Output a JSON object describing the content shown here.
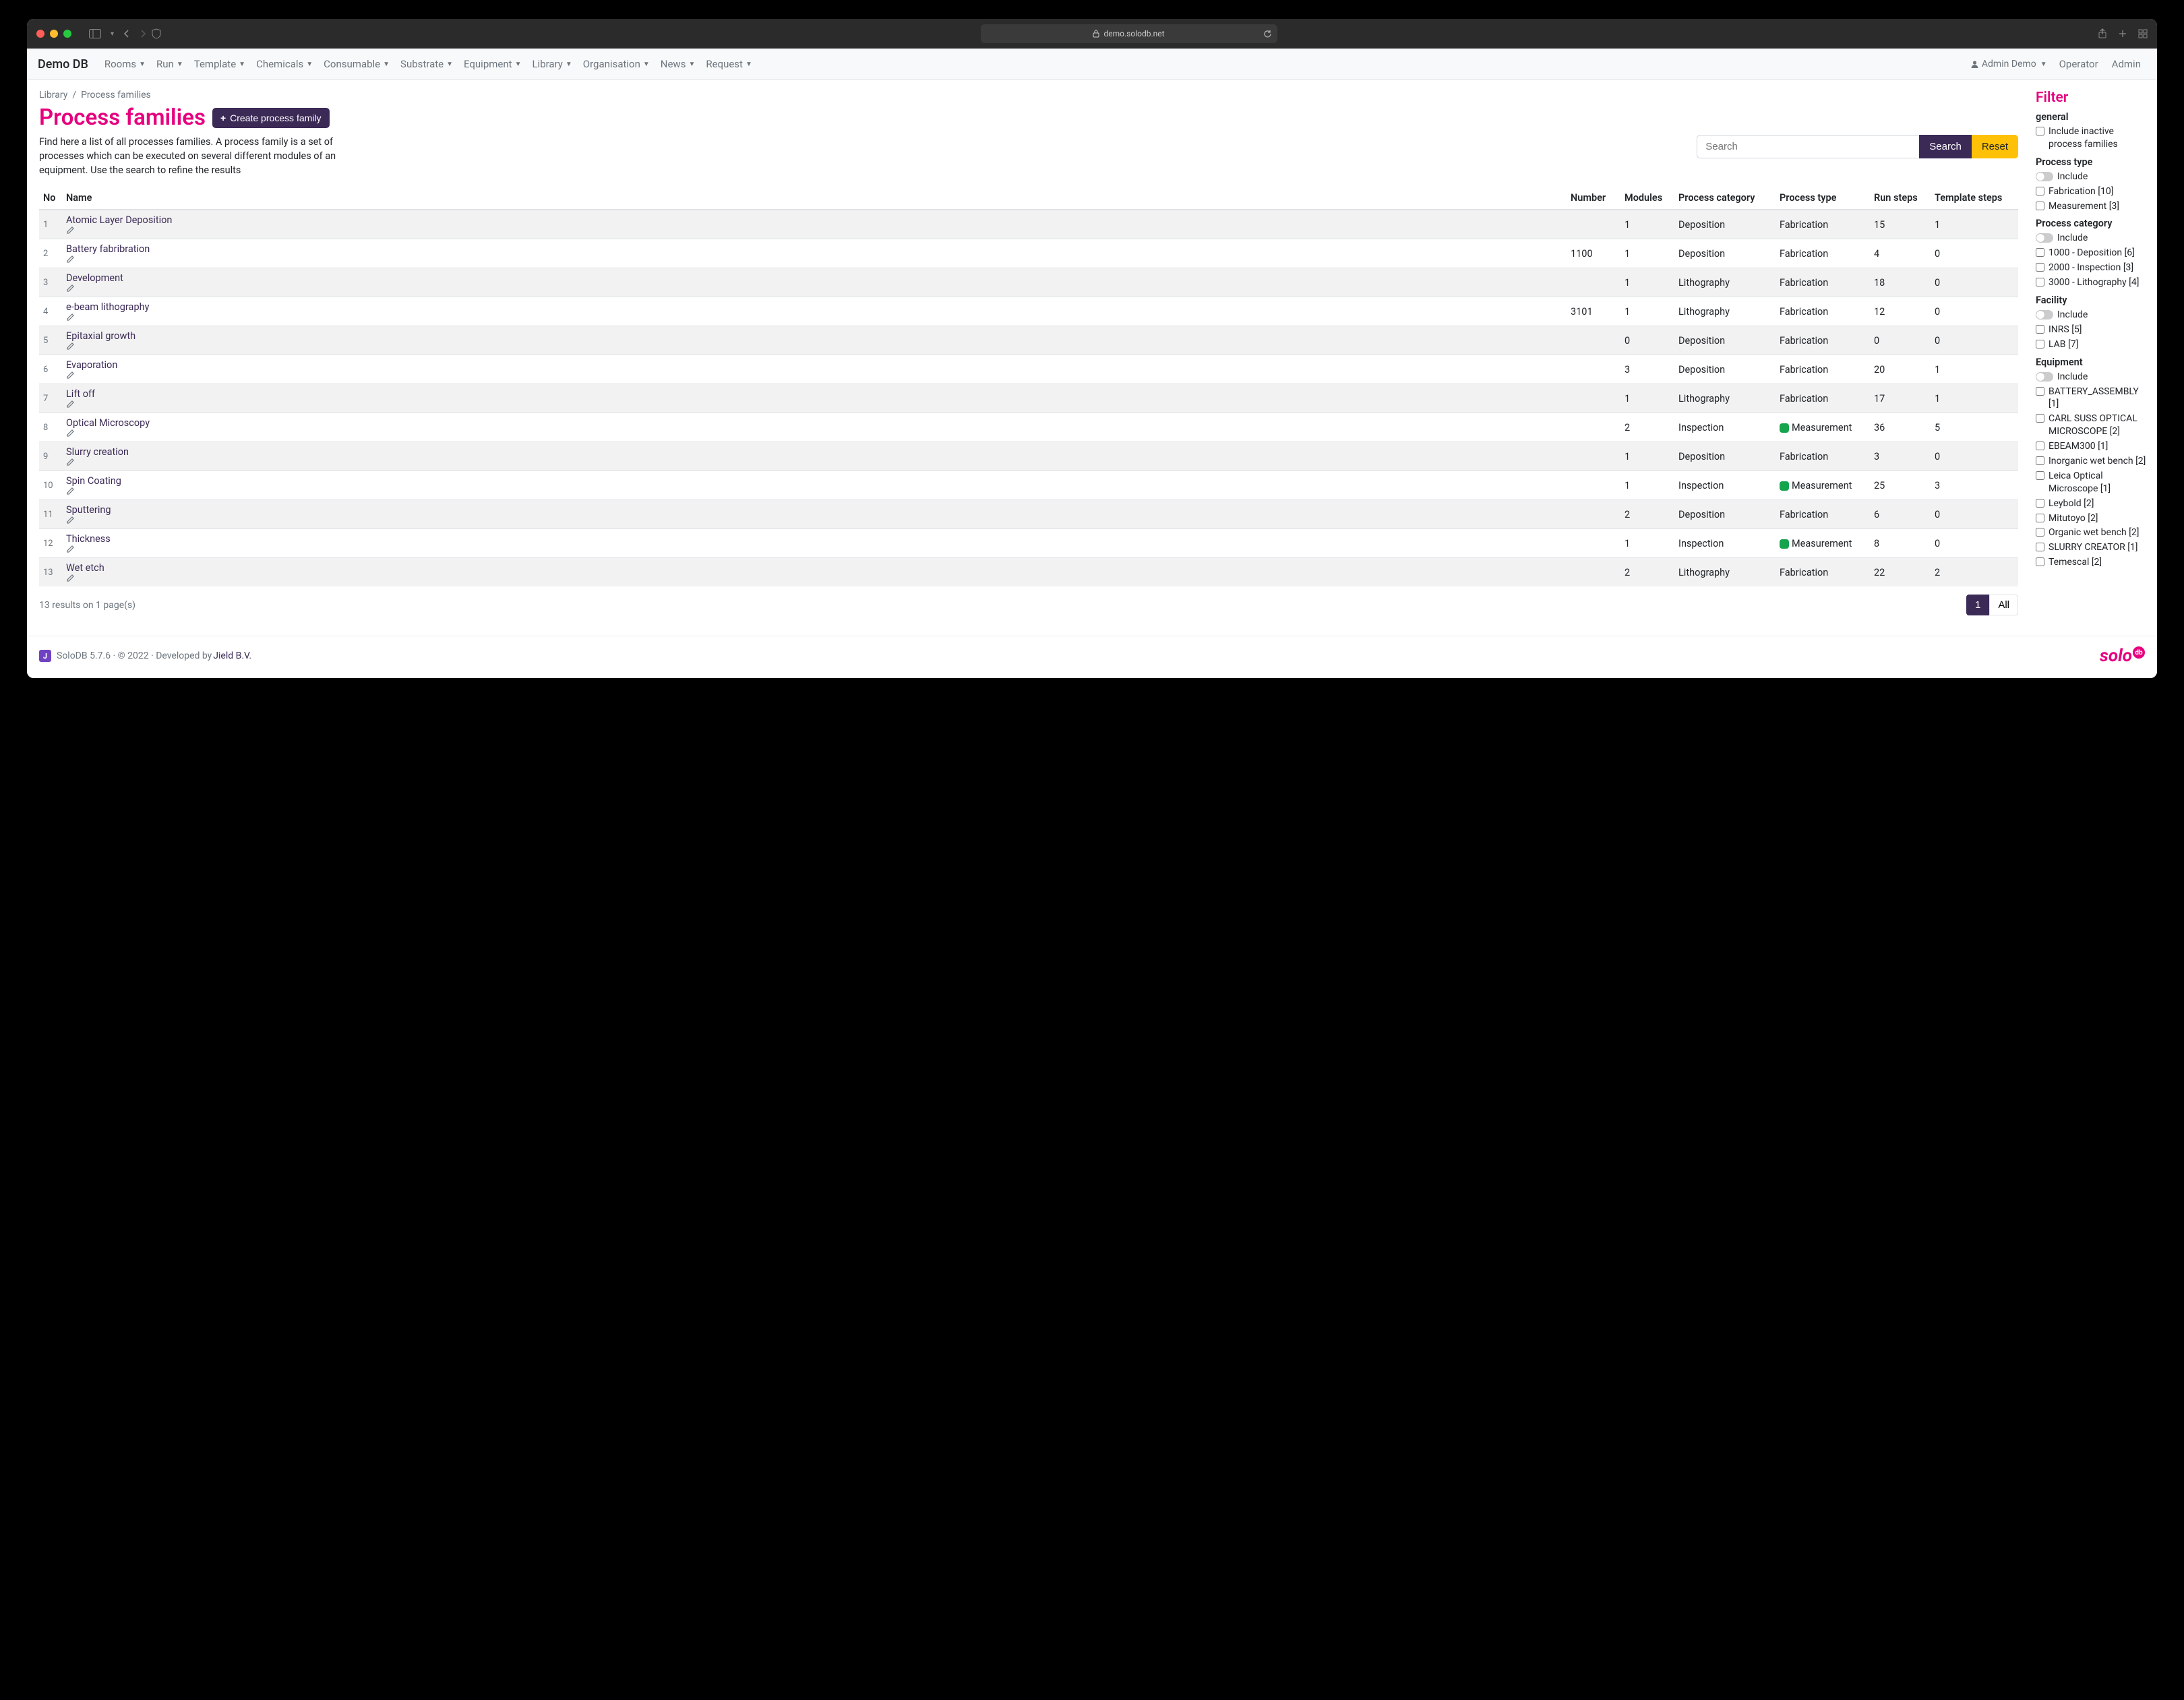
{
  "browser": {
    "url": "demo.solodb.net"
  },
  "brand": "Demo DB",
  "nav": [
    "Rooms",
    "Run",
    "Template",
    "Chemicals",
    "Consumable",
    "Substrate",
    "Equipment",
    "Library",
    "Organisation",
    "News",
    "Request"
  ],
  "nav_right": {
    "user": "Admin Demo",
    "links": [
      "Operator",
      "Admin"
    ]
  },
  "breadcrumb": {
    "root": "Library",
    "current": "Process families"
  },
  "page": {
    "title": "Process families",
    "create_btn": "Create process family",
    "lead": "Find here a list of all processes families. A process family is a set of processes which can be executed on several different modules of an equipment. Use the search to refine the results",
    "search_placeholder": "Search",
    "search_btn": "Search",
    "reset_btn": "Reset"
  },
  "table": {
    "headers": [
      "No",
      "Name",
      "Number",
      "Modules",
      "Process category",
      "Process type",
      "Run steps",
      "Template steps"
    ],
    "rows": [
      {
        "no": "1",
        "name": "Atomic Layer Deposition",
        "number": "",
        "modules": "1",
        "category": "Deposition",
        "type": "Fabrication",
        "run": "15",
        "tmpl": "1"
      },
      {
        "no": "2",
        "name": "Battery fabribration",
        "number": "1100",
        "modules": "1",
        "category": "Deposition",
        "type": "Fabrication",
        "run": "4",
        "tmpl": "0"
      },
      {
        "no": "3",
        "name": "Development",
        "number": "",
        "modules": "1",
        "category": "Lithography",
        "type": "Fabrication",
        "run": "18",
        "tmpl": "0"
      },
      {
        "no": "4",
        "name": "e-beam lithography",
        "number": "3101",
        "modules": "1",
        "category": "Lithography",
        "type": "Fabrication",
        "run": "12",
        "tmpl": "0"
      },
      {
        "no": "5",
        "name": "Epitaxial growth",
        "number": "",
        "modules": "0",
        "category": "Deposition",
        "type": "Fabrication",
        "run": "0",
        "tmpl": "0"
      },
      {
        "no": "6",
        "name": "Evaporation",
        "number": "",
        "modules": "3",
        "category": "Deposition",
        "type": "Fabrication",
        "run": "20",
        "tmpl": "1"
      },
      {
        "no": "7",
        "name": "Lift off",
        "number": "",
        "modules": "1",
        "category": "Lithography",
        "type": "Fabrication",
        "run": "17",
        "tmpl": "1"
      },
      {
        "no": "8",
        "name": "Optical Microscopy",
        "number": "",
        "modules": "2",
        "category": "Inspection",
        "type": "Measurement",
        "run": "36",
        "tmpl": "5"
      },
      {
        "no": "9",
        "name": "Slurry creation",
        "number": "",
        "modules": "1",
        "category": "Deposition",
        "type": "Fabrication",
        "run": "3",
        "tmpl": "0"
      },
      {
        "no": "10",
        "name": "Spin Coating",
        "number": "",
        "modules": "1",
        "category": "Inspection",
        "type": "Measurement",
        "run": "25",
        "tmpl": "3"
      },
      {
        "no": "11",
        "name": "Sputtering",
        "number": "",
        "modules": "2",
        "category": "Deposition",
        "type": "Fabrication",
        "run": "6",
        "tmpl": "0"
      },
      {
        "no": "12",
        "name": "Thickness",
        "number": "",
        "modules": "1",
        "category": "Inspection",
        "type": "Measurement",
        "run": "8",
        "tmpl": "0"
      },
      {
        "no": "13",
        "name": "Wet etch",
        "number": "",
        "modules": "2",
        "category": "Lithography",
        "type": "Fabrication",
        "run": "22",
        "tmpl": "2"
      }
    ]
  },
  "results": {
    "text": "13 results on 1 page(s)",
    "pages": [
      "1",
      "All"
    ],
    "active": 0
  },
  "filter": {
    "title": "Filter",
    "sections": [
      {
        "heading": "general",
        "toggle_label": null,
        "items": [
          "Include inactive process families"
        ]
      },
      {
        "heading": "Process type",
        "toggle_label": "Include",
        "items": [
          "Fabrication [10]",
          "Measurement [3]"
        ]
      },
      {
        "heading": "Process category",
        "toggle_label": "Include",
        "items": [
          "1000 - Deposition [6]",
          "2000 - Inspection [3]",
          "3000 - Lithography [4]"
        ]
      },
      {
        "heading": "Facility",
        "toggle_label": "Include",
        "items": [
          "INRS [5]",
          "LAB [7]"
        ]
      },
      {
        "heading": "Equipment",
        "toggle_label": "Include",
        "items": [
          "BATTERY_ASSEMBLY [1]",
          "CARL SUSS OPTICAL MICROSCOPE [2]",
          "EBEAM300 [1]",
          "Inorganic wet bench [2]",
          "Leica Optical Microscope [1]",
          "Leybold [2]",
          "Mitutoyo [2]",
          "Organic wet bench [2]",
          "SLURRY CREATOR [1]",
          "Temescal [2]"
        ]
      }
    ]
  },
  "footer": {
    "text_pre": "SoloDB 5.7.6 · © 2022 · Developed by ",
    "link": "Jield B.V.",
    "logo": "solo",
    "logo_db": "db"
  }
}
